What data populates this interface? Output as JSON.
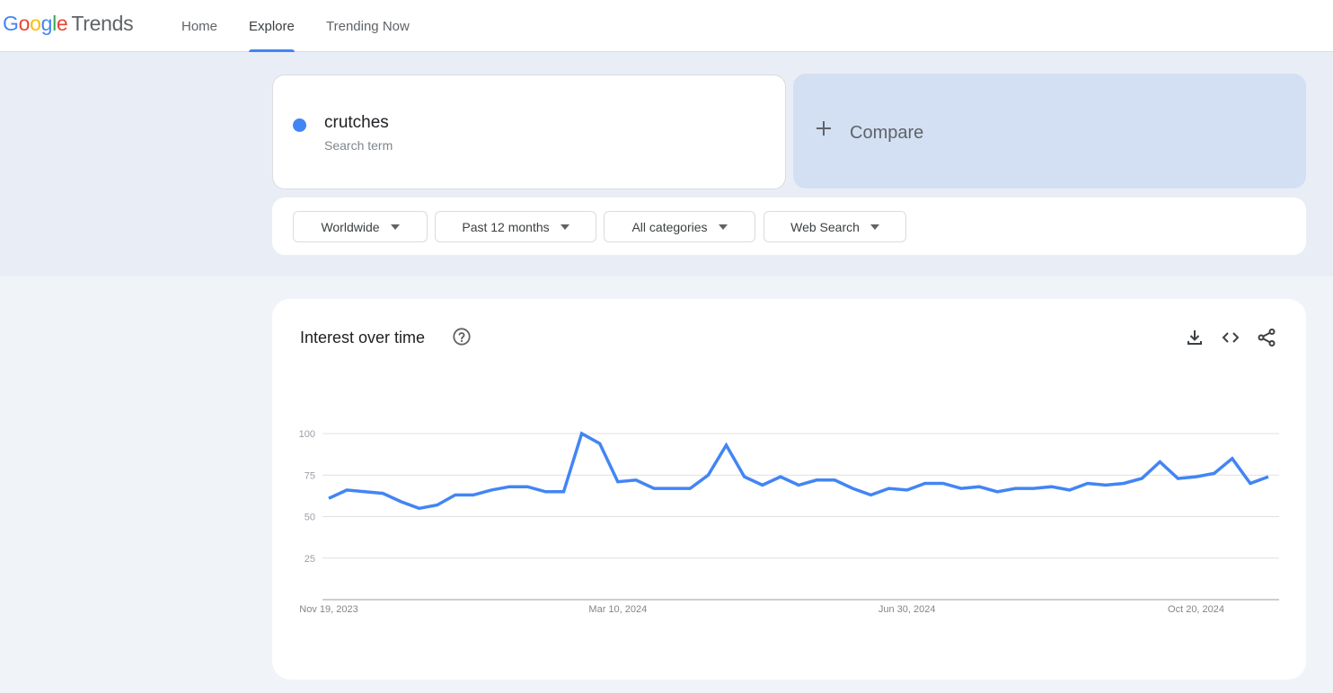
{
  "header": {
    "logo": {
      "google": [
        "G",
        "o",
        "o",
        "g",
        "l",
        "e"
      ],
      "google_colors": [
        "#4285f4",
        "#ea4335",
        "#fbbc05",
        "#4285f4",
        "#34a853",
        "#ea4335"
      ],
      "product": "Trends"
    },
    "nav": [
      {
        "label": "Home",
        "active": false
      },
      {
        "label": "Explore",
        "active": true
      },
      {
        "label": "Trending Now",
        "active": false
      }
    ],
    "accent_color": "#4285f4"
  },
  "search_term": {
    "name": "crutches",
    "type_label": "Search term",
    "color": "#4285f4"
  },
  "compare": {
    "label": "Compare",
    "icon": "plus-icon"
  },
  "filters": [
    {
      "label": "Worldwide"
    },
    {
      "label": "Past 12 months"
    },
    {
      "label": "All categories"
    },
    {
      "label": "Web Search"
    }
  ],
  "interest_panel": {
    "title": "Interest over time",
    "help_icon": "help-circle-icon",
    "actions": [
      {
        "name": "download-icon"
      },
      {
        "name": "embed-code-icon"
      },
      {
        "name": "share-icon"
      }
    ]
  },
  "chart_data": {
    "type": "line",
    "title": "Interest over time",
    "xlabel": "",
    "ylabel": "",
    "ylim": [
      0,
      100
    ],
    "yticks": [
      25,
      50,
      75,
      100
    ],
    "grid": true,
    "x_tick_labels": [
      {
        "index": 0,
        "label": "Nov 19, 2023"
      },
      {
        "index": 16,
        "label": "Mar 10, 2024"
      },
      {
        "index": 32,
        "label": "Jun 30, 2024"
      },
      {
        "index": 48,
        "label": "Oct 20, 2024"
      }
    ],
    "x_start": "Nov 19, 2023",
    "x_interval": "weekly",
    "series": [
      {
        "name": "crutches",
        "color": "#4285f4",
        "values": [
          61,
          66,
          65,
          64,
          59,
          55,
          57,
          63,
          63,
          66,
          68,
          68,
          65,
          65,
          100,
          94,
          71,
          72,
          67,
          67,
          67,
          75,
          93,
          74,
          69,
          74,
          69,
          72,
          72,
          67,
          63,
          67,
          66,
          70,
          70,
          67,
          68,
          65,
          67,
          67,
          68,
          66,
          70,
          69,
          70,
          73,
          83,
          73,
          74,
          76,
          85,
          70,
          74
        ]
      }
    ]
  }
}
